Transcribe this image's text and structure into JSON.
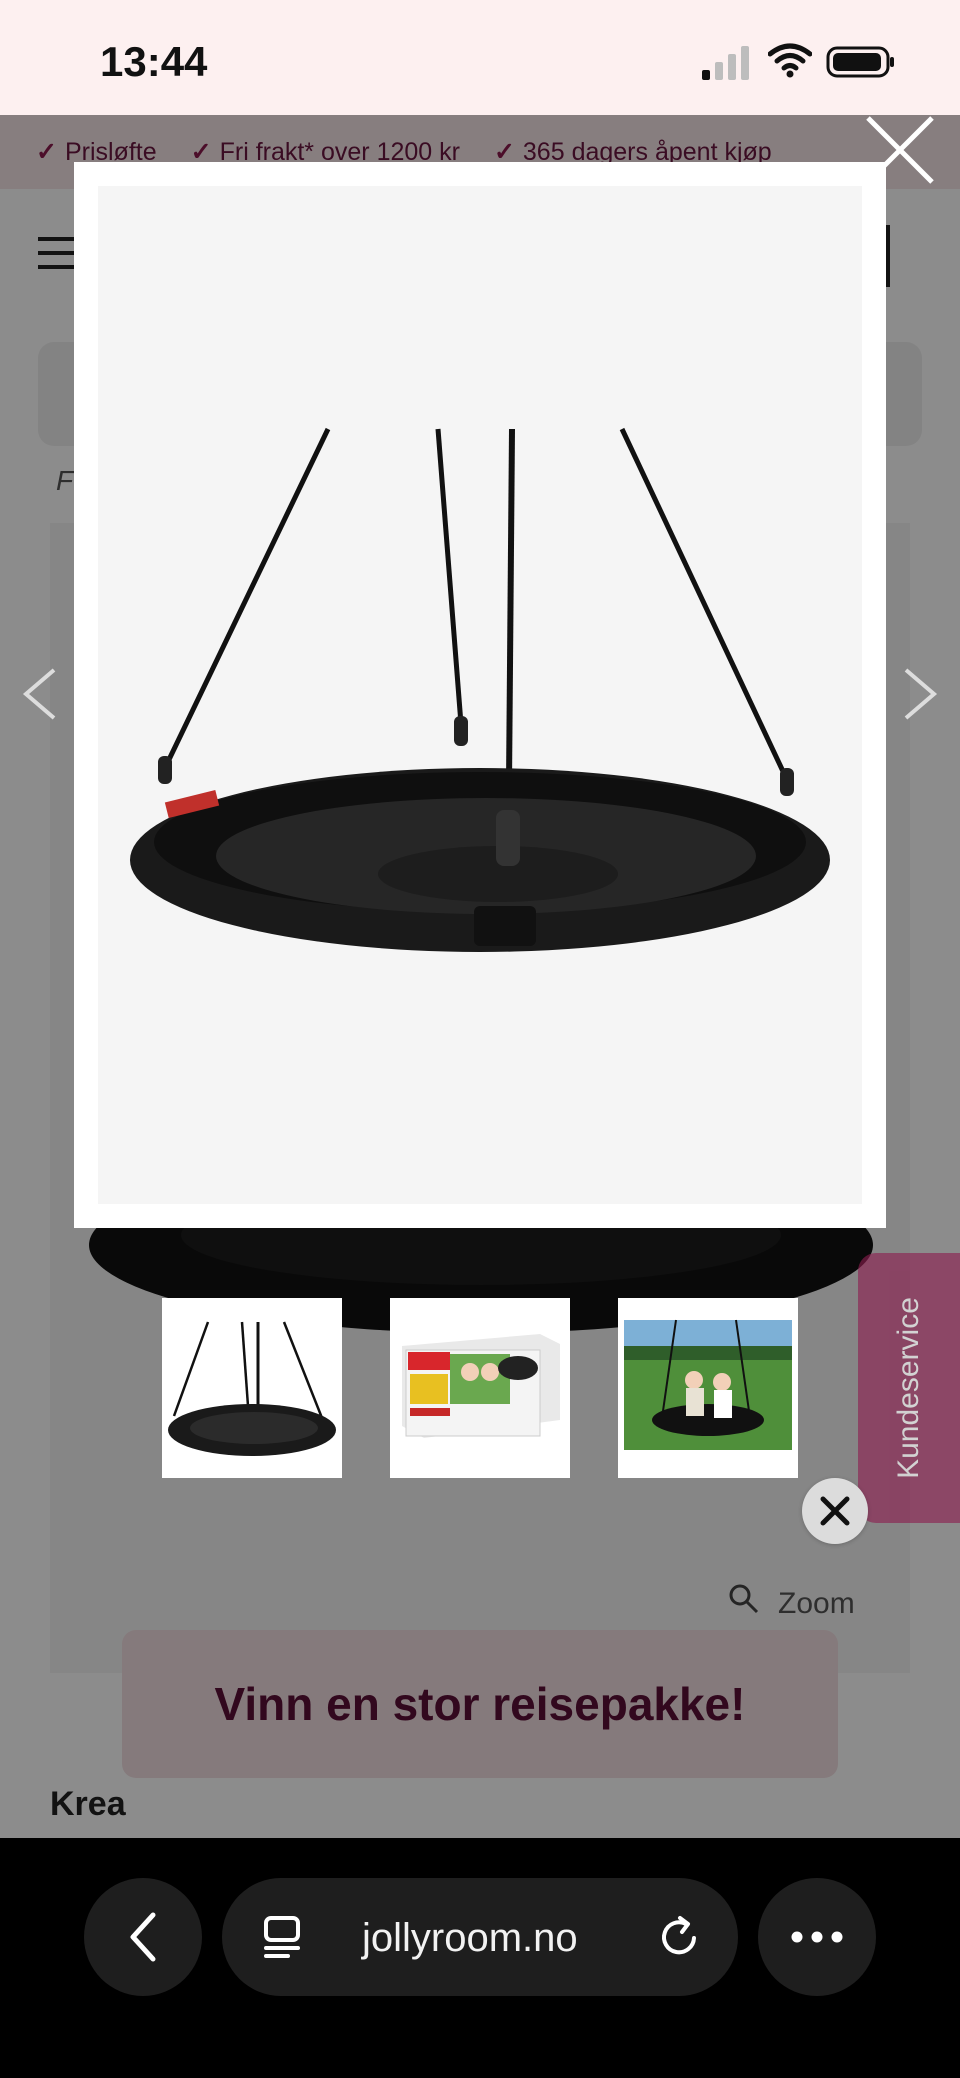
{
  "status_bar": {
    "time": "13:44",
    "icons": [
      "cellular-signal-icon",
      "wifi-icon",
      "battery-icon"
    ]
  },
  "usp_bar": {
    "items": [
      "Prisløfte",
      "Fri frakt* over 1200 kr",
      "365 dagers åpent kjøp"
    ]
  },
  "product": {
    "brand": "Krea",
    "zoom_label": "Zoom"
  },
  "lightbox": {
    "image_alt": "Krea nest swing hanging from four black ropes",
    "thumbnails": [
      {
        "label": "Swing product photo"
      },
      {
        "label": "Swing box packaging"
      },
      {
        "label": "Children on swing outdoors"
      }
    ]
  },
  "customer_service": {
    "label": "Kundeservice"
  },
  "promo": {
    "text": "Vinn en stor reisepakke!"
  },
  "browser": {
    "url": "jollyroom.no"
  },
  "colors": {
    "brand": "#8c1d4f",
    "usp_background": "#f6e6e8",
    "promo_background": "#f3dfe2"
  }
}
